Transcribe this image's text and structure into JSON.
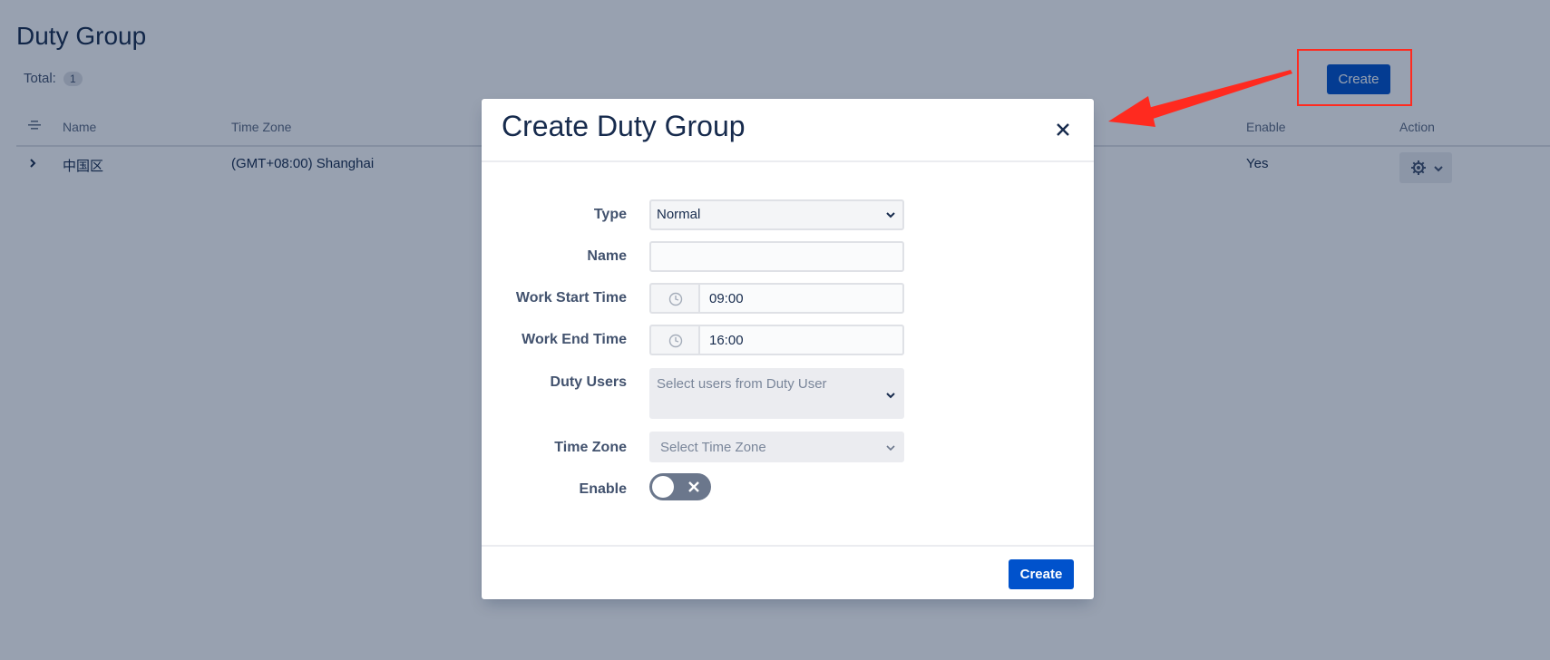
{
  "page": {
    "title": "Duty Group",
    "total_label": "Total:",
    "total_count": "1",
    "create_label": "Create"
  },
  "table": {
    "columns": [
      "Name",
      "Time Zone",
      "Enable",
      "Action"
    ],
    "rows": [
      {
        "name": "中国区",
        "time_zone": "(GMT+08:00) Shanghai",
        "enable": "Yes"
      }
    ]
  },
  "modal": {
    "title": "Create Duty Group",
    "fields": {
      "type": {
        "label": "Type",
        "value": "Normal"
      },
      "name": {
        "label": "Name",
        "value": ""
      },
      "work_start": {
        "label": "Work Start Time",
        "value": "09:00"
      },
      "work_end": {
        "label": "Work End Time",
        "value": "16:00"
      },
      "duty_users": {
        "label": "Duty Users",
        "placeholder": "Select users from Duty User"
      },
      "time_zone": {
        "label": "Time Zone",
        "placeholder": "Select Time Zone"
      },
      "enable": {
        "label": "Enable",
        "state": false
      }
    },
    "submit_label": "Create"
  },
  "colors": {
    "primary": "#0052cc",
    "annotation": "#ff2a1f",
    "toggle_off": "#6b778c"
  }
}
